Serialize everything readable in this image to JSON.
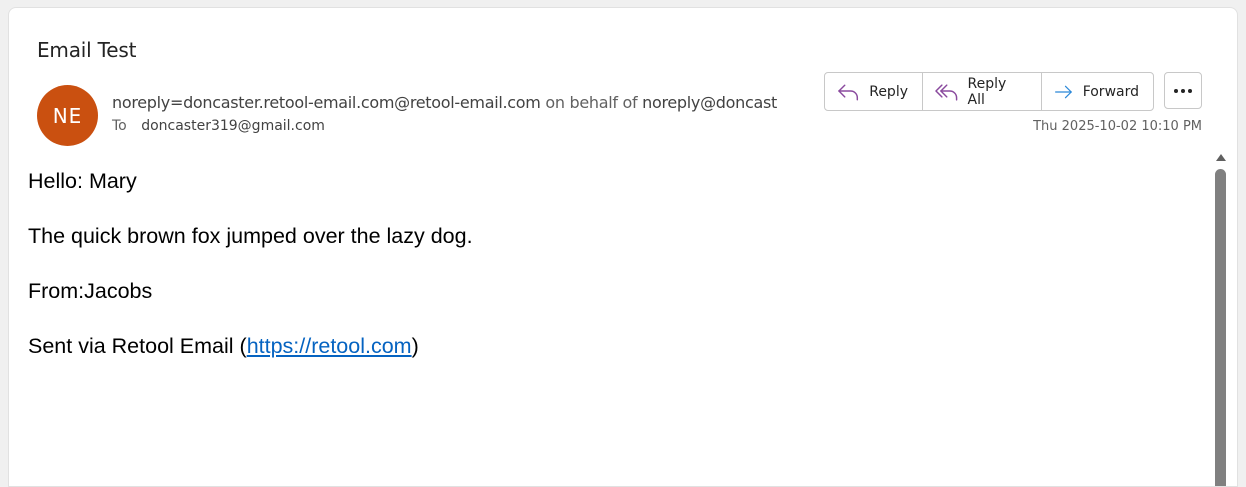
{
  "email": {
    "subject": "Email Test",
    "avatar_initials": "NE",
    "avatar_color": "#ca5010",
    "sender": "noreply=doncaster.retool-email.com@retool-email.com",
    "on_behalf_text": "on behalf of",
    "on_behalf_sender": "noreply@doncast",
    "to_label": "To",
    "to_address": "doncaster319@gmail.com",
    "timestamp": "Thu 2025-10-02 10:10 PM"
  },
  "actions": {
    "reply_label": "Reply",
    "reply_all_label": "Reply All",
    "forward_label": "Forward",
    "more_icon": "more-horizontal-icon"
  },
  "body": {
    "greeting": "Hello: Mary",
    "message": "The quick brown fox jumped over the lazy dog.",
    "from": "From:Jacobs",
    "sent_via_prefix": "Sent via Retool Email (",
    "sent_via_link": "https://retool.com",
    "sent_via_suffix": ")"
  },
  "colors": {
    "link": "#0563c1",
    "reply_icon": "#8a4a9e",
    "forward_icon": "#2b88d8"
  }
}
